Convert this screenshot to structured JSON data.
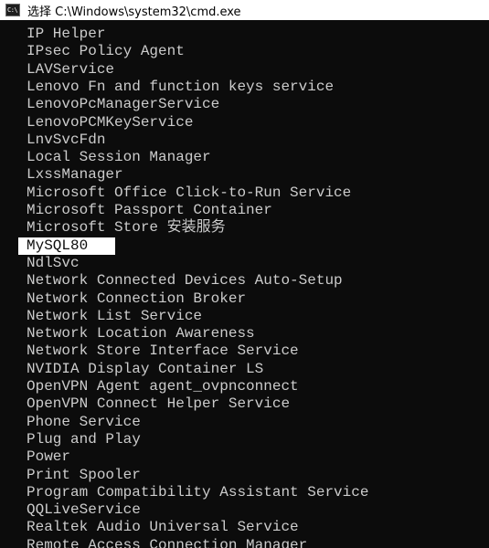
{
  "window": {
    "title": "选择 C:\\Windows\\system32\\cmd.exe",
    "icon_glyph": "C:\\",
    "icon_name": "cmd-console-icon",
    "console_background": "#0c0c0c",
    "console_text_color": "#cccccc",
    "selection_color": "#ffffff"
  },
  "console": {
    "lines": [
      "IP Helper",
      "IPsec Policy Agent",
      "LAVService",
      "Lenovo Fn and function keys service",
      "LenovoPcManagerService",
      "LenovoPCMKeyService",
      "LnvSvcFdn",
      "Local Session Manager",
      "LxssManager",
      "Microsoft Office Click-to-Run Service",
      "Microsoft Passport Container",
      "Microsoft Store 安装服务",
      "MySQL80",
      "NdlSvc",
      "Network Connected Devices Auto-Setup",
      "Network Connection Broker",
      "Network List Service",
      "Network Location Awareness",
      "Network Store Interface Service",
      "NVIDIA Display Container LS",
      "OpenVPN Agent agent_ovpnconnect",
      "OpenVPN Connect Helper Service",
      "Phone Service",
      "Plug and Play",
      "Power",
      "Print Spooler",
      "Program Compatibility Assistant Service",
      "QQLiveService",
      "Realtek Audio Universal Service",
      "Remote Access Connection Manager"
    ],
    "selected_line": "MySQL80"
  }
}
